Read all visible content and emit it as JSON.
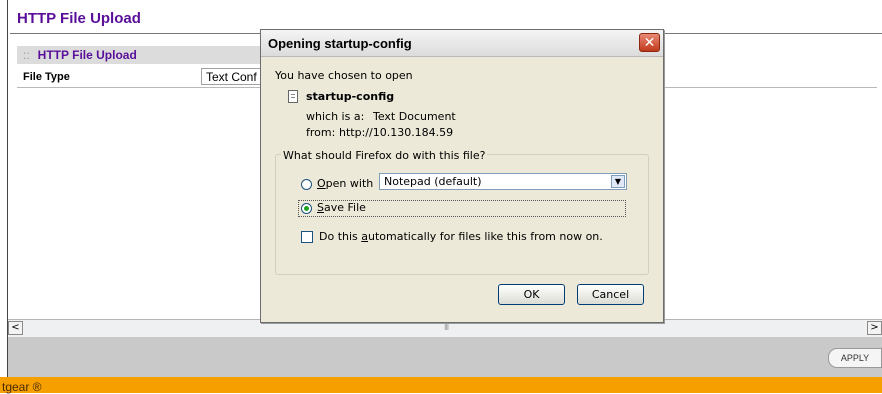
{
  "page": {
    "title": "HTTP File Upload",
    "panel_header": "HTTP File Upload",
    "file_type_label": "File Type",
    "file_type_value": "Text Conf",
    "apply_label": "APPLY",
    "footer_text": "tgear ®",
    "scroll_left": "<",
    "scroll_right": ">",
    "scroll_grip": "III"
  },
  "dialog": {
    "title": "Opening startup-config",
    "close_glyph": "✕",
    "intro": "You have chosen to open",
    "file_name": "startup-config",
    "which_is_label": "which is a:",
    "which_is_value": "Text Document",
    "from_label": "from:",
    "from_value": "http://10.130.184.59",
    "group_legend": "What should Firefox do with this file?",
    "open_with_prefix": "O",
    "open_with_rest": "pen with",
    "open_with_app": "Notepad (default)",
    "save_prefix": "S",
    "save_rest": "ave File",
    "auto_pre": "Do this ",
    "auto_key": "a",
    "auto_rest": "utomatically for files like this from now on.",
    "ok_label": "OK",
    "cancel_label": "Cancel",
    "selected_option": "save_file"
  },
  "colors": {
    "title_purple": "#5a0f9a",
    "footer_orange": "#f5a000",
    "dialog_bg": "#ece9d8",
    "close_red": "#c1391c"
  }
}
